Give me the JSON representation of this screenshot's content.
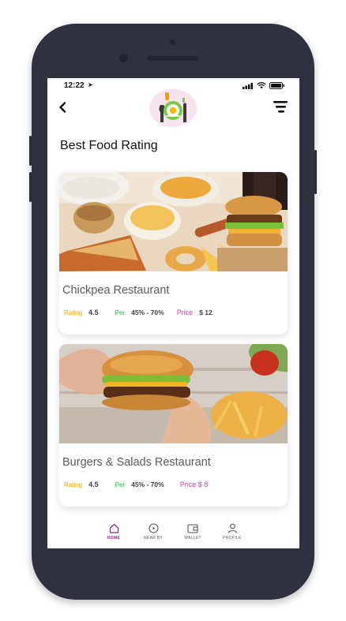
{
  "status_bar": {
    "time": "12:22"
  },
  "header": {
    "logo_icon": "food-plate-logo-icon",
    "back_icon": "chevron-left-icon",
    "filter_icon": "filter-icon"
  },
  "page": {
    "title": "Best Food Rating"
  },
  "restaurants": [
    {
      "name": "Chickpea Restaurant",
      "rating_label": "Rating",
      "rating": "4.5",
      "per_label": "Per",
      "per": "45% - 70%",
      "price_label": "Price",
      "price": "$ 12",
      "image": "fast-food-spread-photo"
    },
    {
      "name": "Burgers & Salads Restaurant",
      "rating_label": "Rating",
      "rating": "4.5",
      "per_label": "Per",
      "per": "45% - 70%",
      "price_label": "Price $ 8",
      "image": "burger-hands-photo"
    }
  ],
  "bottom_nav": [
    {
      "label": "HOME",
      "icon": "home-icon",
      "active": true
    },
    {
      "label": "NEAR BY",
      "icon": "compass-icon",
      "active": false
    },
    {
      "label": "WALLET",
      "icon": "wallet-icon",
      "active": false
    },
    {
      "label": "PROFILE",
      "icon": "user-icon",
      "active": false
    }
  ],
  "colors": {
    "rating": "#f0a500",
    "per": "#2bb24c",
    "price": "#c2469e",
    "nav_active": "#9a1f8b",
    "phone_body": "#30313f"
  }
}
